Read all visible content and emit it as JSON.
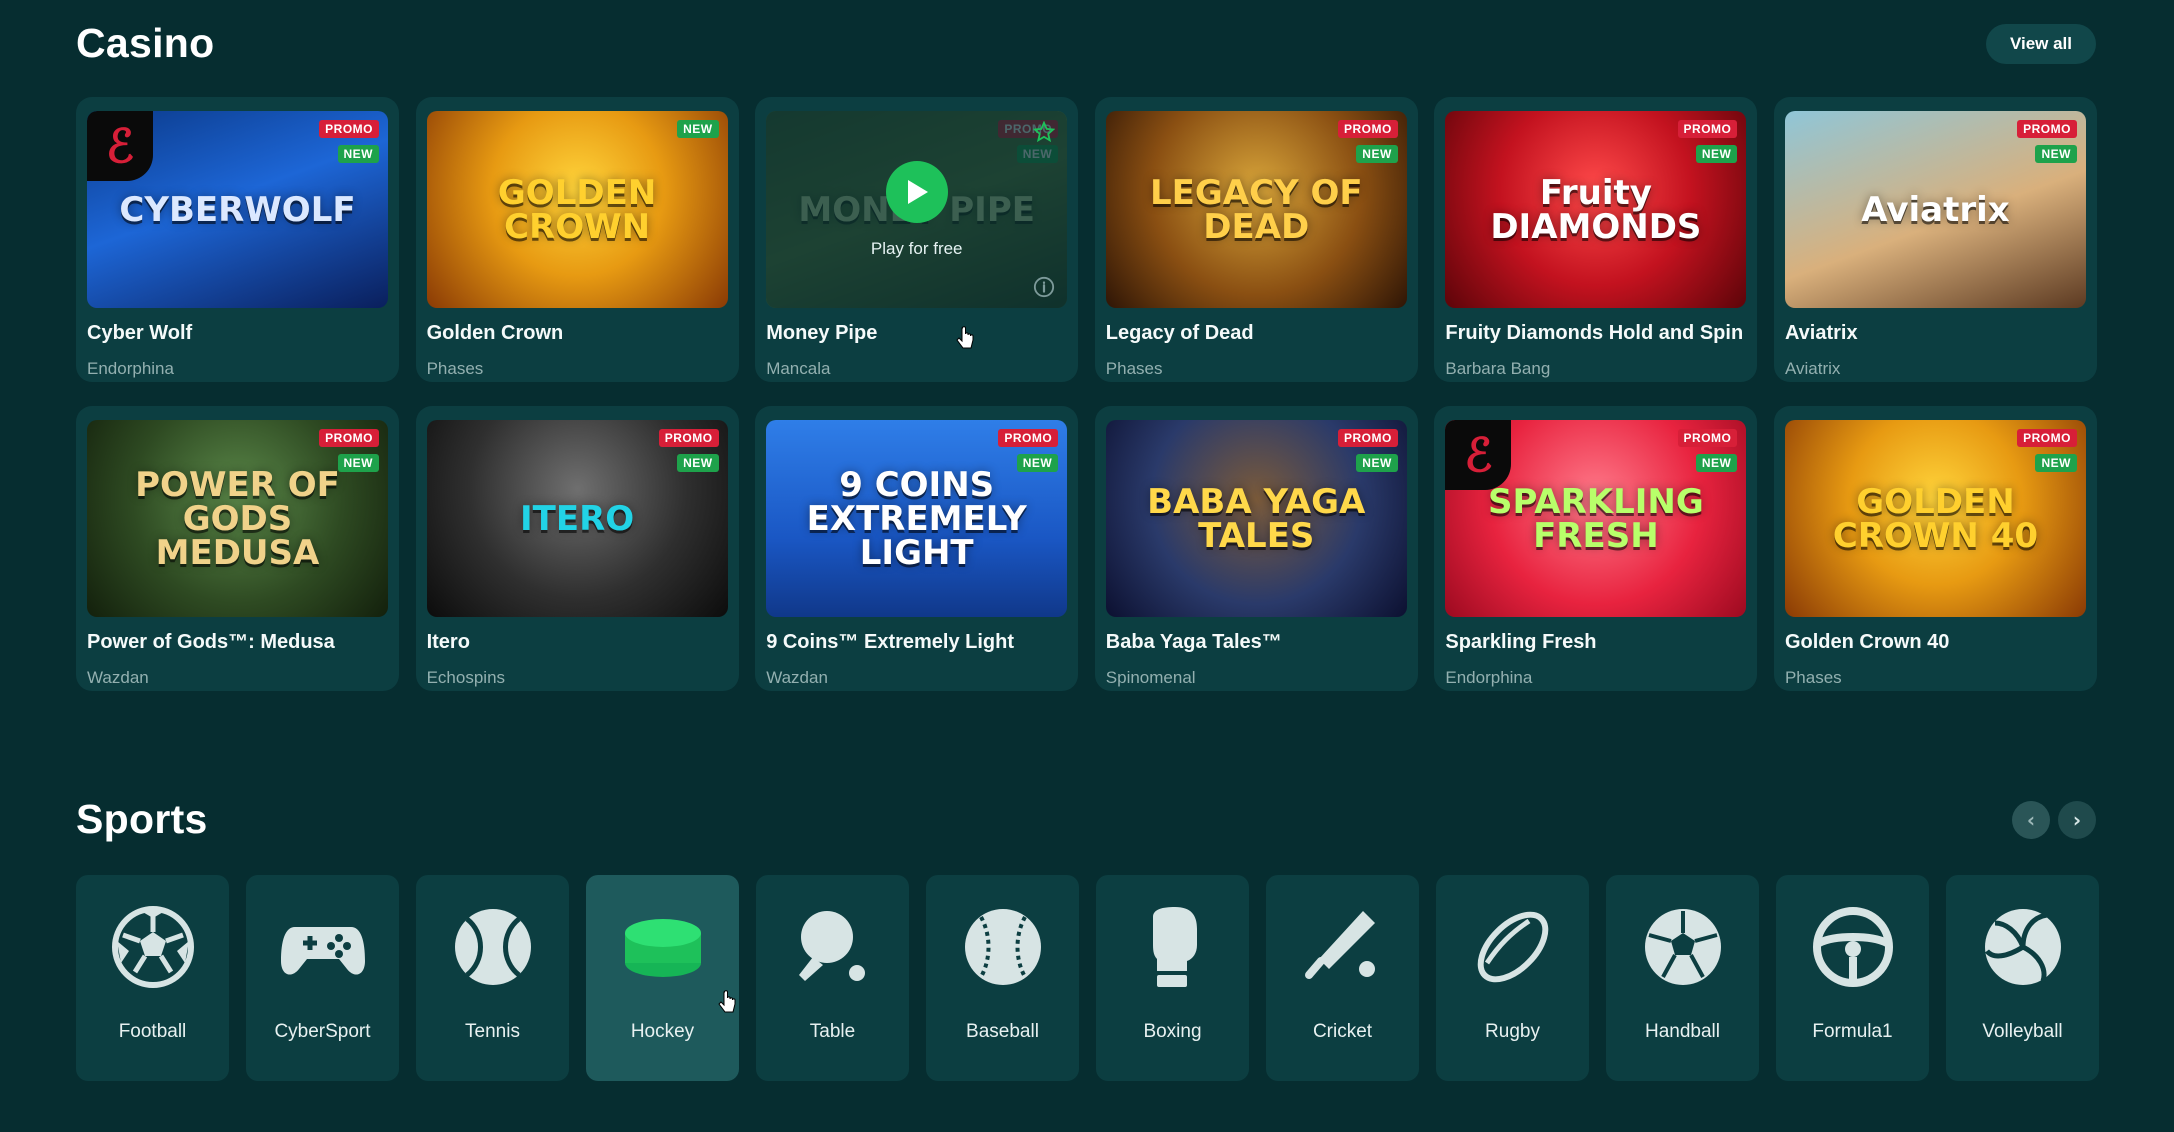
{
  "casino": {
    "title": "Casino",
    "view_all_label": "View all",
    "games": [
      {
        "name": "Cyber Wolf",
        "provider": "Endorphina",
        "art_text": "CYBERWOLF",
        "badges": [
          "PROMO",
          "NEW"
        ],
        "bg": "linear-gradient(160deg,#0b3a8a 0%,#1d66d6 45%,#0a1f5c 100%)",
        "text_color": "#dbe8ff"
      },
      {
        "name": "Golden Crown",
        "provider": "Phases",
        "art_text": "GOLDEN CROWN",
        "badges": [
          "NEW"
        ],
        "bg": "radial-gradient(circle at 50% 40%,#ffd43b 0%,#e79a12 45%,#8a3a05 100%)",
        "text_color": "#ffd02e"
      },
      {
        "name": "Money Pipe",
        "provider": "Mancala",
        "art_text": "MONEY PIPE",
        "badges": [
          "PROMO",
          "NEW"
        ],
        "bg": "linear-gradient(160deg,#3c5a2e 0%,#5a7a3a 50%,#2a3f22 100%)",
        "text_color": "#c9e2a0",
        "hovered": true,
        "play_label": "Play for free"
      },
      {
        "name": "Legacy of Dead",
        "provider": "Phases",
        "art_text": "LEGACY OF DEAD",
        "badges": [
          "PROMO",
          "NEW"
        ],
        "bg": "radial-gradient(circle at 50% 40%,#d8a53a 0%,#8a4f12 55%,#2e1506 100%)",
        "text_color": "#ffcf4a"
      },
      {
        "name": "Fruity Diamonds Hold and Spin",
        "provider": "Barbara Bang",
        "art_text": "Fruity DIAMONDS",
        "badges": [
          "PROMO",
          "NEW"
        ],
        "bg": "radial-gradient(circle at 50% 40%,#ff4a4a 0%,#c3121f 50%,#5c0409 100%)",
        "text_color": "#ffffff"
      },
      {
        "name": "Aviatrix",
        "provider": "Aviatrix",
        "art_text": "Aviatrix",
        "badges": [
          "PROMO",
          "NEW"
        ],
        "bg": "linear-gradient(160deg,#8fc6d8 0%,#d9b07c 55%,#5c3a22 100%)",
        "text_color": "#ffffff"
      },
      {
        "name": "Power of Gods™: Medusa",
        "provider": "Wazdan",
        "art_text": "POWER OF GODS MEDUSA",
        "badges": [
          "PROMO",
          "NEW"
        ],
        "bg": "radial-gradient(circle at 50% 40%,#5c8a4a 0%,#2e4a22 55%,#13200c 100%)",
        "text_color": "#f0d28a"
      },
      {
        "name": "Itero",
        "provider": "Echospins",
        "art_text": "ITERO",
        "badges": [
          "PROMO",
          "NEW"
        ],
        "bg": "radial-gradient(circle at 50% 35%,#6f6f6f 0%,#2f2f2f 55%,#0c0c0c 100%)",
        "text_color": "#22d3e6"
      },
      {
        "name": "9 Coins™ Extremely Light",
        "provider": "Wazdan",
        "art_text": "9 COINS EXTREMELY LIGHT",
        "badges": [
          "PROMO",
          "NEW"
        ],
        "bg": "linear-gradient(180deg,#2f7ee8 0%,#1a57c4 60%,#10388a 100%)",
        "text_color": "#ffffff"
      },
      {
        "name": "Baba Yaga Tales™",
        "provider": "Spinomenal",
        "art_text": "BABA YAGA TALES",
        "badges": [
          "PROMO",
          "NEW"
        ],
        "bg": "radial-gradient(circle at 50% 40%,#7a5a3a 0%,#2a3a6a 55%,#0c1030 100%)",
        "text_color": "#ffd84a"
      },
      {
        "name": "Sparkling Fresh",
        "provider": "Endorphina",
        "art_text": "SPARKLING FRESH",
        "badges": [
          "PROMO",
          "NEW"
        ],
        "bg": "radial-gradient(circle at 50% 40%,#ff7a8a 0%,#e8233f 55%,#9c0a20 100%)",
        "text_color": "#b8ff6a"
      },
      {
        "name": "Golden Crown 40",
        "provider": "Phases",
        "art_text": "GOLDEN CROWN 40",
        "badges": [
          "PROMO",
          "NEW"
        ],
        "bg": "radial-gradient(circle at 50% 40%,#ffd43b 0%,#e79a12 45%,#8a3a05 100%)",
        "text_color": "#ffd02e"
      }
    ]
  },
  "sports": {
    "title": "Sports",
    "prev_glyph": "‹",
    "next_glyph": "›",
    "items": [
      {
        "label": "Football",
        "icon": "football-icon"
      },
      {
        "label": "CyberSport",
        "icon": "gamepad-icon"
      },
      {
        "label": "Tennis",
        "icon": "tennis-ball-icon"
      },
      {
        "label": "Hockey",
        "icon": "hockey-puck-icon",
        "active": true
      },
      {
        "label": "Table",
        "icon": "table-tennis-icon"
      },
      {
        "label": "Baseball",
        "icon": "baseball-icon"
      },
      {
        "label": "Boxing",
        "icon": "boxing-glove-icon"
      },
      {
        "label": "Cricket",
        "icon": "cricket-icon"
      },
      {
        "label": "Rugby",
        "icon": "rugby-ball-icon"
      },
      {
        "label": "Handball",
        "icon": "handball-icon"
      },
      {
        "label": "Formula1",
        "icon": "steering-wheel-icon"
      },
      {
        "label": "Volleyball",
        "icon": "volleyball-icon"
      }
    ]
  },
  "colors": {
    "background": "#062d30",
    "card": "#0c3e41",
    "accent_green": "#1ec15a",
    "promo_red": "#d71f38",
    "new_green": "#1ea24b"
  }
}
